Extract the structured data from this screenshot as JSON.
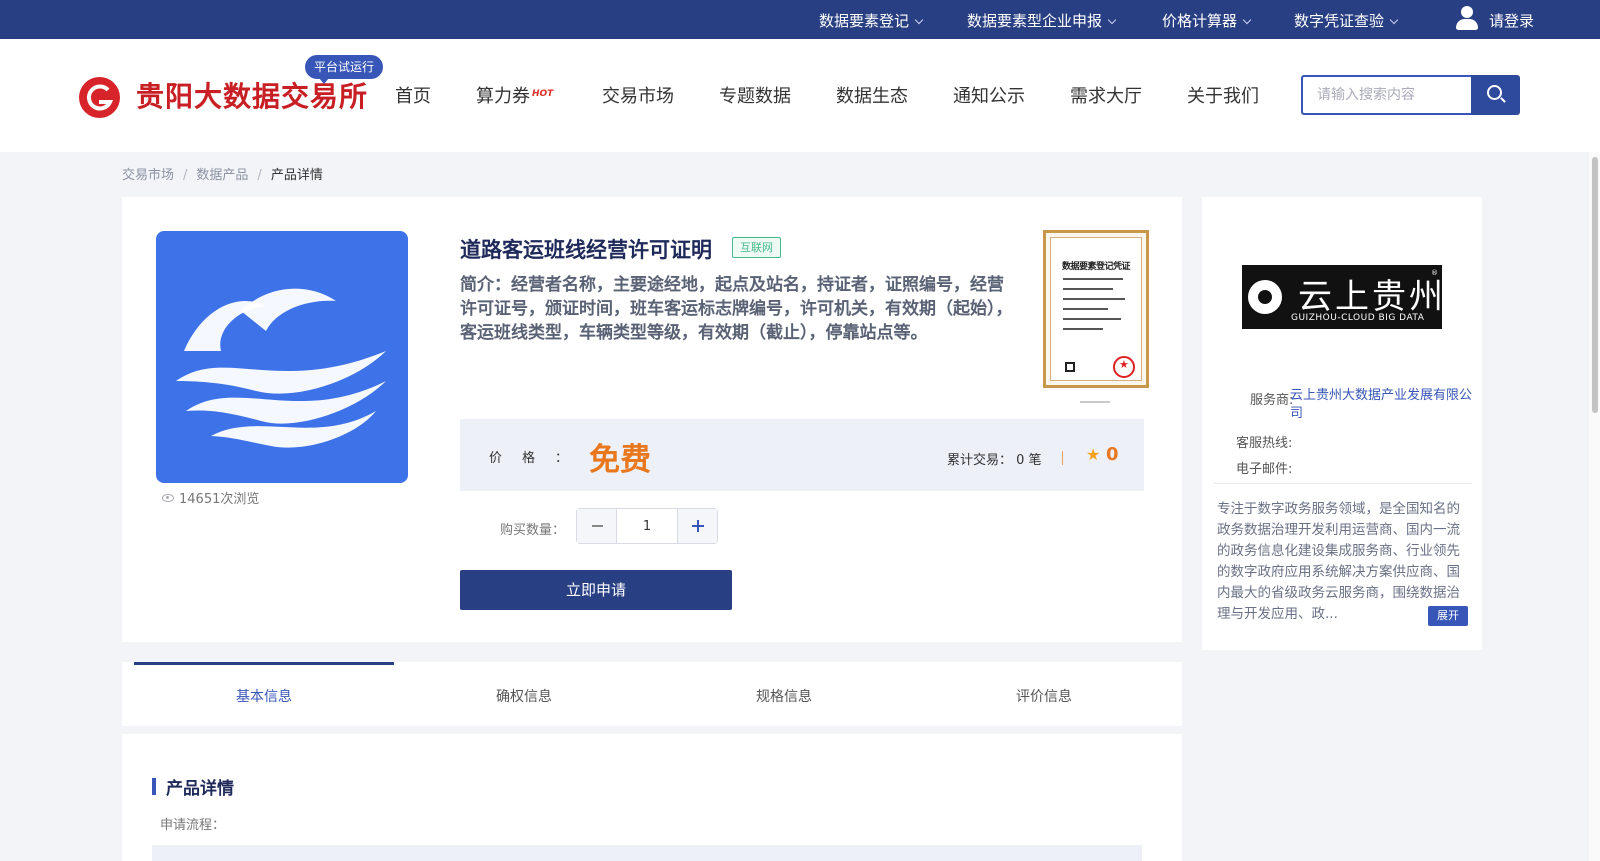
{
  "topbar": {
    "items": [
      {
        "label": "数据要素登记"
      },
      {
        "label": "数据要素型企业申报"
      },
      {
        "label": "价格计算器"
      },
      {
        "label": "数字凭证查验"
      }
    ],
    "login_label": "请登录",
    "bg_color": "#293f83"
  },
  "header": {
    "logo_text": "贵阳大数据交易所",
    "trial_badge": "平台试运行",
    "nav": [
      "首页",
      "算力券",
      "交易市场",
      "专题数据",
      "数据生态",
      "通知公示",
      "需求大厅",
      "关于我们"
    ],
    "hot_tag": "HOT",
    "search_placeholder": "请输入搜索内容"
  },
  "breadcrumb": {
    "items": [
      "交易市场",
      "数据产品"
    ],
    "current": "产品详情",
    "separator": "/"
  },
  "product": {
    "title": "道路客运班线经营许可证明",
    "tag": "互联网",
    "description": "简介：经营者名称，主要途经地，起点及站名，持证者，证照编号，经营许可证号，颁证时间，班车客运标志牌编号，许可机关，有效期（起始），客运班线类型，车辆类型等级，有效期（截止），停靠站点等。",
    "views": "14651次浏览",
    "certificate_title": "数据要素登记凭证",
    "price_label": "价格：",
    "price_value": "免费",
    "trade_label": "累计交易：",
    "trade_count": "0 笔",
    "score": "0",
    "qty_label": "购买数量：",
    "qty_value": "1",
    "apply_label": "立即申请",
    "accent_color": "#e8771e"
  },
  "provider": {
    "logo_cn": "云上贵州",
    "logo_en": "GUIZHOU-CLOUD BIG DATA",
    "service_label": "服务商:",
    "service_name": "云上贵州大数据产业发展有限公司",
    "hotline_label": "客服热线:",
    "email_label": "电子邮件:",
    "intro": "专注于数字政务服务领域，是全国知名的政务数据治理开发利用运营商、国内一流的政务信息化建设集成服务商、行业领先的数字政府应用系统解决方案供应商、国内最大的省级政务云服务商，围绕数据治理与开发应用、政...",
    "expand_label": "展开"
  },
  "tabs": [
    "基本信息",
    "确权信息",
    "规格信息",
    "评价信息"
  ],
  "detail": {
    "title": "产品详情",
    "flow_label": "申请流程："
  }
}
